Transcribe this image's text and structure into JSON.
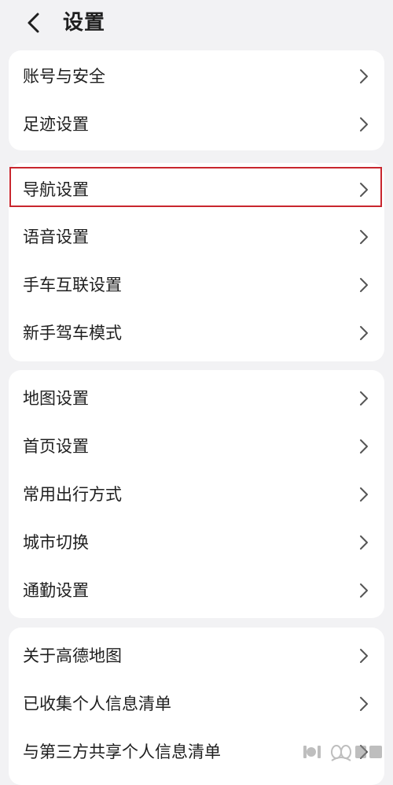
{
  "header": {
    "back_icon": "chevron-left-icon",
    "title": "设置"
  },
  "groups": [
    {
      "items": [
        {
          "label": "账号与安全"
        },
        {
          "label": "足迹设置"
        }
      ]
    },
    {
      "items": [
        {
          "label": "导航设置",
          "highlighted": true
        },
        {
          "label": "语音设置"
        },
        {
          "label": "手车互联设置"
        },
        {
          "label": "新手驾车模式"
        }
      ]
    },
    {
      "items": [
        {
          "label": "地图设置"
        },
        {
          "label": "首页设置"
        },
        {
          "label": "常用出行方式"
        },
        {
          "label": "城市切换"
        },
        {
          "label": "通勤设置"
        }
      ]
    },
    {
      "items": [
        {
          "label": "关于高德地图"
        },
        {
          "label": "已收集个人信息清单"
        },
        {
          "label": "与第三方共享个人信息清单"
        }
      ]
    }
  ],
  "highlight_color": "#c8262e",
  "row_icon": "chevron-right-icon"
}
